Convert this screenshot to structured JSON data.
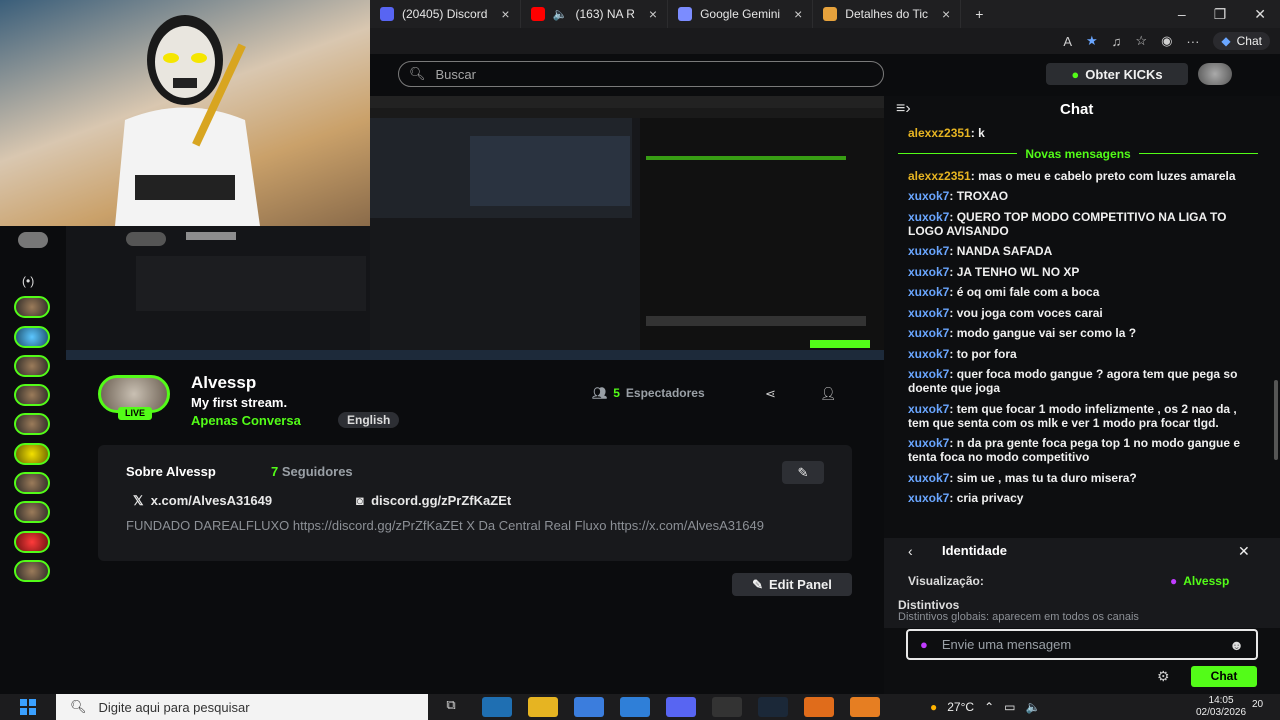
{
  "browser": {
    "tabs": [
      {
        "label": "(20405) Discord",
        "icon": "discord-icon",
        "color": "#5865f2"
      },
      {
        "label": "(163) NA R",
        "icon": "youtube-icon",
        "color": "#ff0000"
      },
      {
        "label": "Google Gemini",
        "icon": "gemini-icon",
        "color": "#7b8cff"
      },
      {
        "label": "Detalhes do Tic",
        "icon": "folder-icon",
        "color": "#e6a23c"
      }
    ],
    "new_tab": "+",
    "chat_pill": "Chat"
  },
  "kick": {
    "search_placeholder": "Buscar",
    "kicks_button": "Obter KICKs",
    "brand_green": "#53fc18"
  },
  "channel": {
    "name": "Alvessp",
    "title": "My first stream.",
    "category": "Apenas Conversa",
    "language": "English",
    "live_badge": "LIVE",
    "viewers_count": "5",
    "viewers_label": "Espectadores"
  },
  "about": {
    "title": "Sobre Alvessp",
    "followers_count": "7",
    "followers_label": "Seguidores",
    "link_x": "x.com/AlvesA31649",
    "link_discord": "discord.gg/zPrZfKaZEt",
    "description": "FUNDADO DAREALFLUXO https://discord.gg/zPrZfKaZEt X Da Central Real Fluxo https://x.com/AlvesA31649",
    "edit_panel": "Edit Panel"
  },
  "chat": {
    "title": "Chat",
    "new_messages": "Novas mensagens",
    "messages_before": [
      {
        "user": "alexxz2351",
        "color": "#e6b422",
        "text": "k"
      }
    ],
    "messages": [
      {
        "user": "alexxz2351",
        "color": "#e6b422",
        "text": "mas o meu e cabelo preto com luzes amarela"
      },
      {
        "user": "xuxok7",
        "color": "#6aa6ff",
        "text": "TROXAO"
      },
      {
        "user": "xuxok7",
        "color": "#6aa6ff",
        "text": "QUERO TOP MODO COMPETITIVO NA LIGA TO LOGO AVISANDO"
      },
      {
        "user": "xuxok7",
        "color": "#6aa6ff",
        "text": "NANDA SAFADA"
      },
      {
        "user": "xuxok7",
        "color": "#6aa6ff",
        "text": "JA TENHO WL NO XP"
      },
      {
        "user": "xuxok7",
        "color": "#6aa6ff",
        "text": "é oq omi fale com a boca"
      },
      {
        "user": "xuxok7",
        "color": "#6aa6ff",
        "text": "vou joga com voces carai"
      },
      {
        "user": "xuxok7",
        "color": "#6aa6ff",
        "text": "modo gangue vai ser como la ?"
      },
      {
        "user": "xuxok7",
        "color": "#6aa6ff",
        "text": "to por fora"
      },
      {
        "user": "xuxok7",
        "color": "#6aa6ff",
        "text": "quer foca modo gangue ? agora tem que pega so doente que joga"
      },
      {
        "user": "xuxok7",
        "color": "#6aa6ff",
        "text": "tem que focar 1 modo infelizmente , os 2 nao da , tem que senta com os mlk e ver 1 modo pra focar tlgd."
      },
      {
        "user": "xuxok7",
        "color": "#6aa6ff",
        "text": "n da pra gente foca pega top 1 no modo gangue e tenta foca no modo competitivo"
      },
      {
        "user": "xuxok7",
        "color": "#6aa6ff",
        "text": "sim ue , mas tu ta duro misera?"
      },
      {
        "user": "xuxok7",
        "color": "#6aa6ff",
        "text": "cria privacy"
      }
    ],
    "identity": {
      "title": "Identidade",
      "visualization_label": "Visualização:",
      "visualization_name": "Alvessp",
      "badges_title": "Distintivos",
      "badges_desc": "Distintivos globais: aparecem em todos os canais"
    },
    "input_placeholder": "Envie uma mensagem",
    "send_button": "Chat"
  },
  "taskbar": {
    "search_placeholder": "Digite aqui para pesquisar",
    "temperature": "27°C",
    "time": "14:05",
    "date": "02/03/2026",
    "notifications": "20"
  }
}
